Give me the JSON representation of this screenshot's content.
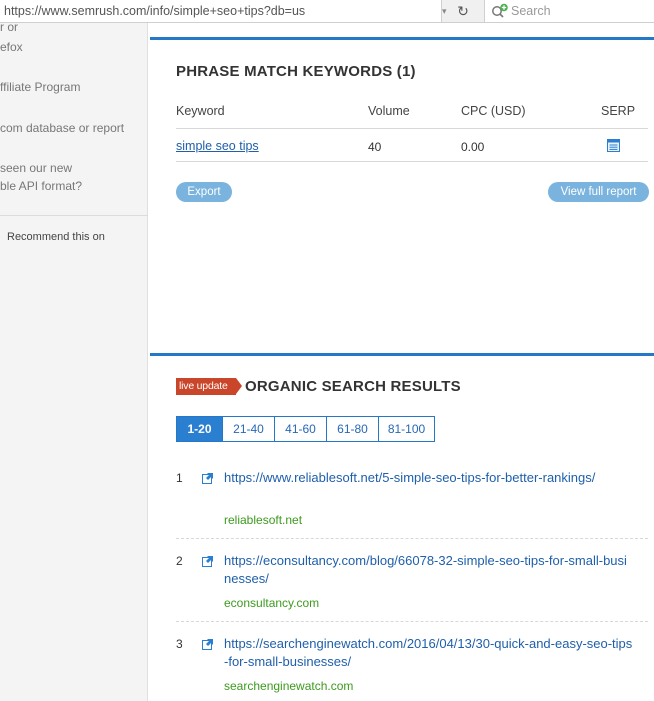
{
  "browser": {
    "url": "https://www.semrush.com/info/simple+seo+tips?db=us",
    "search_placeholder": "Search"
  },
  "sidebar": {
    "lines": [
      "r or",
      "efox",
      "ffiliate Program",
      "com database or report",
      "seen our new",
      "ble API format?"
    ],
    "recommend": "Recommend this on"
  },
  "phrase_match": {
    "title": "PHRASE MATCH KEYWORDS (1)",
    "columns": [
      "Keyword",
      "Volume",
      "CPC (USD)",
      "SERP"
    ],
    "rows": [
      {
        "keyword": "simple seo tips",
        "volume": "40",
        "cpc": "0.00"
      }
    ],
    "export_label": "Export",
    "full_report_label": "View full report"
  },
  "organic": {
    "badge": "live update",
    "title": "ORGANIC SEARCH RESULTS",
    "pages": [
      "1-20",
      "21-40",
      "41-60",
      "61-80",
      "81-100"
    ],
    "active_page": "1-20",
    "results": [
      {
        "rank": "1",
        "url": "https://www.reliablesoft.net/5-simple-seo-tips-for-better-rankings/",
        "domain": "reliablesoft.net"
      },
      {
        "rank": "2",
        "url": "https://econsultancy.com/blog/66078-32-simple-seo-tips-for-small-businesses/",
        "domain": "econsultancy.com"
      },
      {
        "rank": "3",
        "url": "https://searchenginewatch.com/2016/04/13/30-quick-and-easy-seo-tips-for-small-businesses/",
        "domain": "searchenginewatch.com"
      }
    ]
  },
  "colors": {
    "accent": "#2578c8",
    "link": "#1f5fab",
    "domain": "#3c9a1e",
    "badge": "#c9462b"
  }
}
